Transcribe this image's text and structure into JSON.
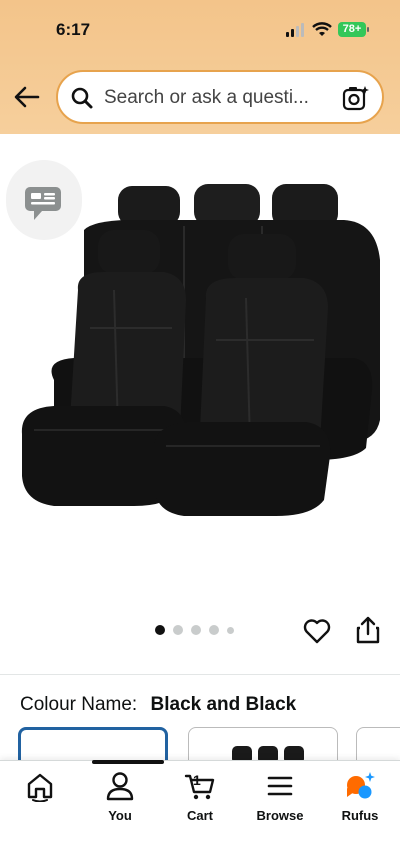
{
  "status": {
    "time": "6:17",
    "battery": "78+"
  },
  "search": {
    "placeholder": "Search or ask a questi..."
  },
  "product": {
    "image_count": 5,
    "active_image": 1
  },
  "variation": {
    "label": "Colour Name:",
    "value": "Black and Black"
  },
  "nav": {
    "you": "You",
    "cart": "Cart",
    "cart_count": "1",
    "browse": "Browse",
    "rufus": "Rufus"
  },
  "colors": {
    "header": "#f3c48a",
    "accent": "#2162a1",
    "rufus_orange": "#ff6b00",
    "rufus_blue": "#1a98ff"
  }
}
